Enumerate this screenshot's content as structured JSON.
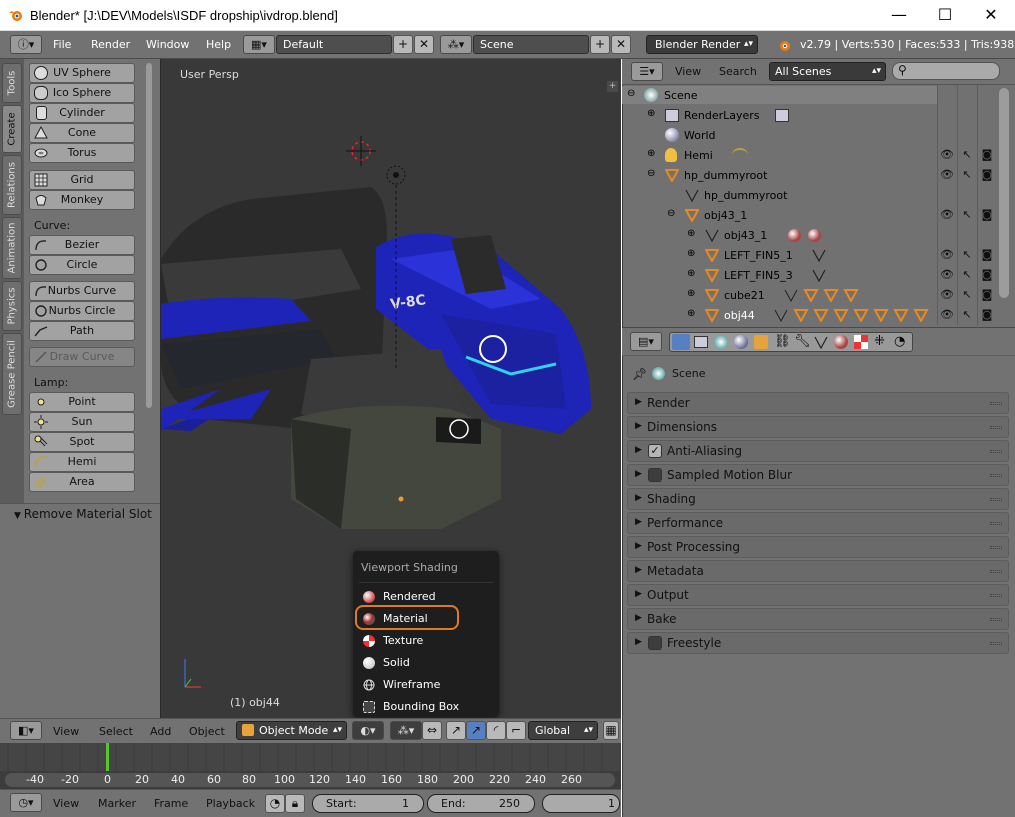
{
  "window": {
    "title": "Blender* [J:\\DEV\\Models\\ISDF dropship\\ivdrop.blend]",
    "minimize": "—",
    "maximize": "☐",
    "close": "✕"
  },
  "topbar": {
    "menus": [
      "File",
      "Render",
      "Window",
      "Help"
    ],
    "layout": "Default",
    "scene": "Scene",
    "engine": "Blender Render",
    "stats": "v2.79 | Verts:530 | Faces:533 | Tris:938 |"
  },
  "shelf": {
    "tabs": [
      "Tools",
      "Create",
      "Relations",
      "Animation",
      "Physics",
      "Grease Pencil"
    ],
    "mesh_items": [
      "UV Sphere",
      "Ico Sphere",
      "Cylinder",
      "Cone",
      "Torus"
    ],
    "mesh_items2": [
      "Grid",
      "Monkey"
    ],
    "curve_label": "Curve:",
    "curve_items": [
      "Bezier",
      "Circle"
    ],
    "curve_items2": [
      "Nurbs Curve",
      "Nurbs Circle",
      "Path"
    ],
    "draw_curve": "Draw Curve",
    "lamp_label": "Lamp:",
    "lamp_items": [
      "Point",
      "Sun",
      "Spot",
      "Hemi",
      "Area"
    ],
    "operator_panel": "Remove Material Slot"
  },
  "viewport": {
    "view_label": "User Persp",
    "object_label": "(1) obj44",
    "header": {
      "menus": [
        "View",
        "Select",
        "Add",
        "Object"
      ],
      "mode": "Object Mode",
      "orientation": "Global"
    },
    "shading_popup": {
      "title": "Viewport Shading",
      "items": [
        "Rendered",
        "Material",
        "Texture",
        "Solid",
        "Wireframe",
        "Bounding Box"
      ],
      "highlighted": "Material"
    }
  },
  "timeline": {
    "ticks": [
      "-40",
      "-20",
      "0",
      "20",
      "40",
      "60",
      "80",
      "100",
      "120",
      "140",
      "160",
      "180",
      "200",
      "220",
      "240",
      "260"
    ],
    "current_frame": 0,
    "header": {
      "menus": [
        "View",
        "Marker",
        "Frame",
        "Playback"
      ],
      "start_label": "Start:",
      "start_value": "1",
      "end_label": "End:",
      "end_value": "250",
      "current_value": "1"
    }
  },
  "outliner": {
    "header": {
      "view": "View",
      "search": "Search",
      "filter": "All Scenes"
    },
    "rows": [
      {
        "label": "Scene"
      },
      {
        "label": "RenderLayers"
      },
      {
        "label": "World"
      },
      {
        "label": "Hemi"
      },
      {
        "label": "hp_dummyroot"
      },
      {
        "label": "hp_dummyroot"
      },
      {
        "label": "obj43_1"
      },
      {
        "label": "obj43_1"
      },
      {
        "label": "LEFT_FIN5_1"
      },
      {
        "label": "LEFT_FIN5_3"
      },
      {
        "label": "cube21"
      },
      {
        "label": "obj44"
      }
    ]
  },
  "properties": {
    "context": "Scene",
    "panels": [
      {
        "label": "Render"
      },
      {
        "label": "Dimensions"
      },
      {
        "label": "Anti-Aliasing",
        "checked": true
      },
      {
        "label": "Sampled Motion Blur",
        "checked": false
      },
      {
        "label": "Shading"
      },
      {
        "label": "Performance"
      },
      {
        "label": "Post Processing"
      },
      {
        "label": "Metadata"
      },
      {
        "label": "Output"
      },
      {
        "label": "Bake"
      },
      {
        "label": "Freestyle",
        "checked": false
      }
    ],
    "check_mark": "✓"
  },
  "colors": {
    "accent_orange": "#e07a27",
    "blender_gray": "#727272",
    "viewport_bg": "#393939",
    "ship_blue": "#1f24b8"
  }
}
